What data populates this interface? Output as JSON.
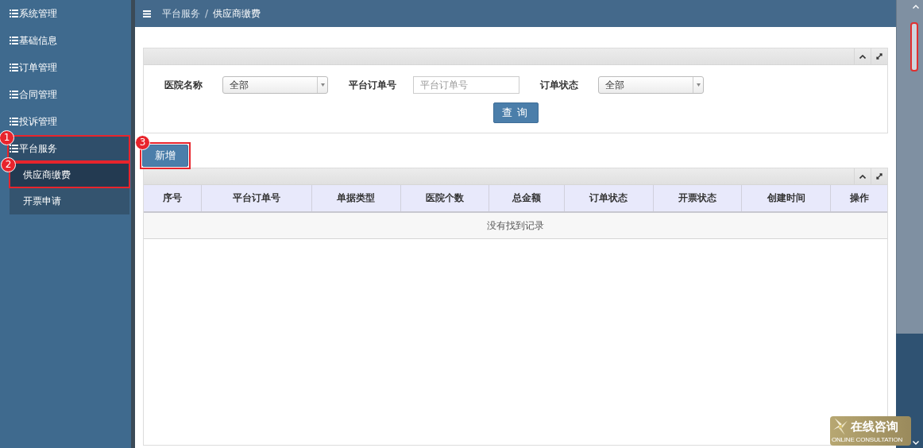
{
  "sidebar": {
    "items": [
      {
        "label": "系统管理",
        "expanded": false
      },
      {
        "label": "基础信息",
        "expanded": false
      },
      {
        "label": "订单管理",
        "expanded": false
      },
      {
        "label": "合同管理",
        "expanded": false
      },
      {
        "label": "投诉管理",
        "expanded": false
      },
      {
        "label": "平台服务",
        "expanded": true,
        "callout": "1",
        "children": [
          {
            "label": "供应商缴费",
            "selected": true,
            "callout": "2"
          },
          {
            "label": "开票申请",
            "selected": false
          }
        ]
      }
    ]
  },
  "breadcrumb": {
    "items": [
      "平台服务",
      "供应商缴费"
    ],
    "separator": "/"
  },
  "filter_panel": {
    "fields": [
      {
        "kind": "select",
        "label": "医院名称",
        "value": "全部"
      },
      {
        "kind": "input",
        "label": "平台订单号",
        "placeholder": "平台订单号"
      },
      {
        "kind": "select",
        "label": "订单状态",
        "value": "全部"
      }
    ],
    "search_button": "查询"
  },
  "add_button": {
    "label": "新增",
    "callout": "3"
  },
  "table": {
    "columns": [
      "序号",
      "平台订单号",
      "单据类型",
      "医院个数",
      "总金额",
      "订单状态",
      "开票状态",
      "创建时间",
      "操作"
    ],
    "empty_message": "没有找到记录"
  },
  "chat_widget": {
    "title": "在线咨询",
    "subtitle": "ONLINE CONSULTATION"
  }
}
